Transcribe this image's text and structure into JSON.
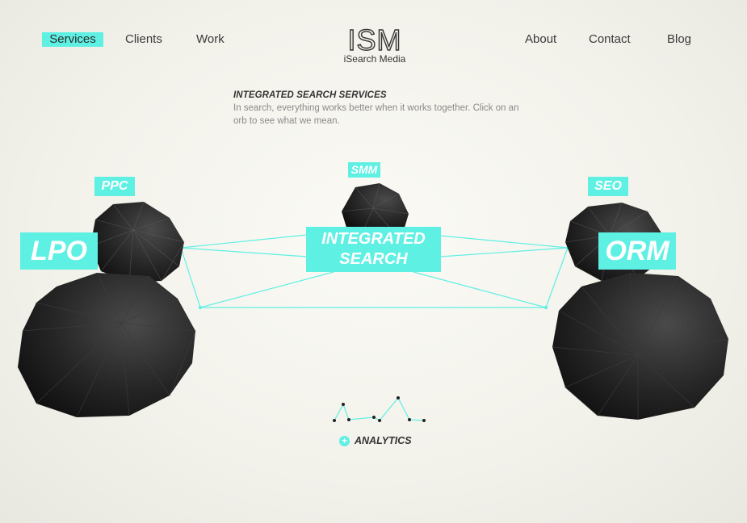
{
  "nav": {
    "left": [
      {
        "label": "Services",
        "active": true
      },
      {
        "label": "Clients"
      },
      {
        "label": "Work"
      }
    ],
    "right": [
      {
        "label": "About"
      },
      {
        "label": "Contact"
      },
      {
        "label": "Blog"
      }
    ]
  },
  "brand": {
    "logo_text": "ISM",
    "subtitle": "iSearch Media"
  },
  "intro": {
    "title": "INTEGRATED SEARCH SERVICES",
    "body": "In search, everything works better when it works together. Click on an orb to see what we mean."
  },
  "orbs": {
    "ppc": "PPC",
    "smm": "SMM",
    "seo": "SEO",
    "lpo": "LPO",
    "orm": "ORM",
    "center_line1": "INTEGRATED",
    "center_line2": "SEARCH"
  },
  "analytics": {
    "icon_glyph": "+",
    "label": "ANALYTICS"
  },
  "colors": {
    "accent": "#5ff0e4",
    "orb_dark": "#232323",
    "background": "#f4f3ec"
  }
}
